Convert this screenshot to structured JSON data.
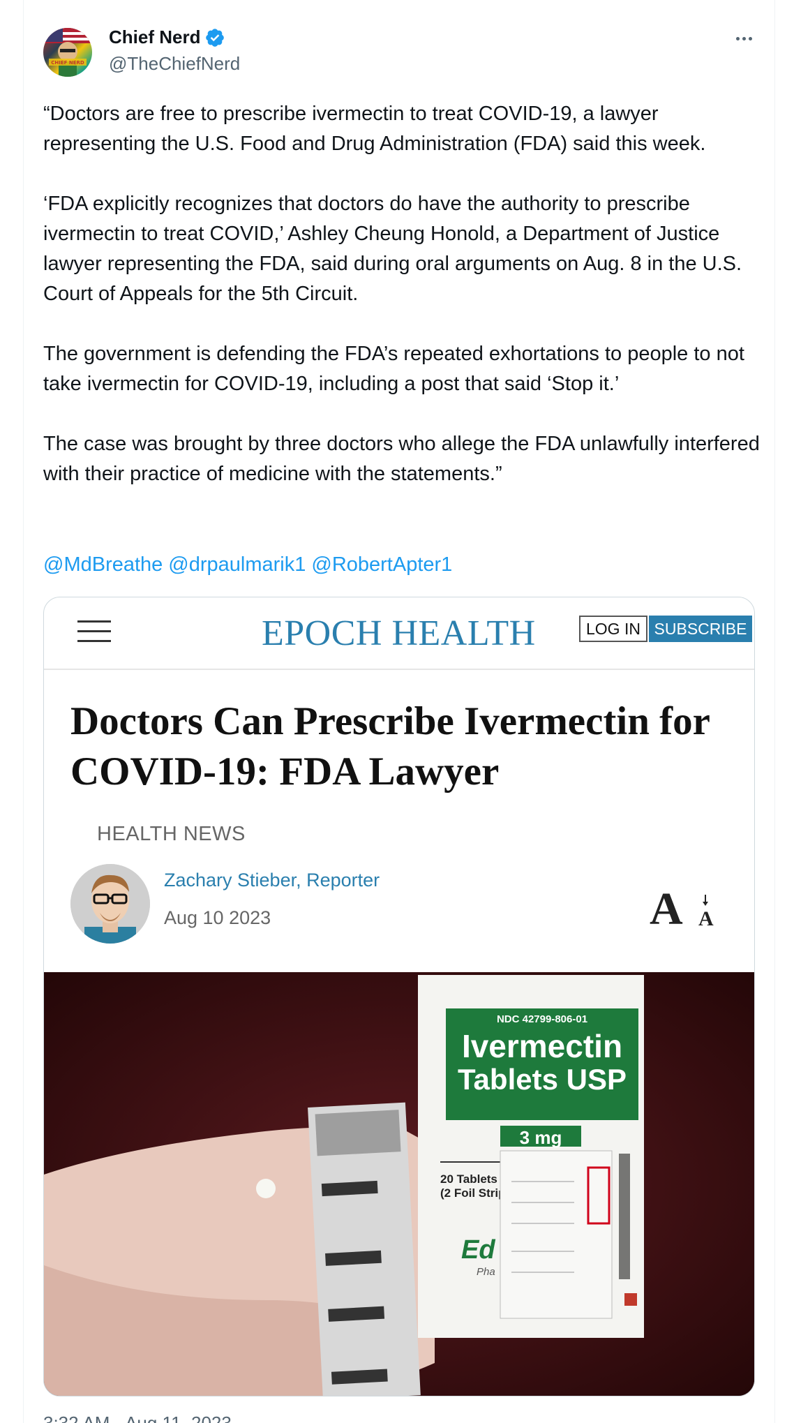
{
  "tweet": {
    "display_name": "Chief Nerd",
    "handle": "@TheChiefNerd",
    "avatar_text": "CHIEF NERD",
    "paragraphs": [
      "“Doctors are free to prescribe ivermectin to treat COVID-19, a lawyer representing the U.S. Food and Drug Administration (FDA) said this week.",
      "‘FDA explicitly recognizes that doctors do have the authority to prescribe ivermectin to treat COVID,’ Ashley Cheung Honold, a Department of Justice lawyer representing the FDA, said during oral arguments on Aug. 8 in the U.S. Court of Appeals for the 5th Circuit.",
      "The government is defending the FDA’s repeated exhortations to people to not take ivermectin for COVID-19, including a post that said ‘Stop it.’",
      "The case was brought by three doctors who allege the FDA unlawfully interfered with their practice of medicine with the statements.”"
    ],
    "mentions": [
      "@MdBreathe",
      "@drpaulmarik1",
      "@RobertApter1"
    ],
    "timestamp": "3:32 AM · Aug 11, 2023"
  },
  "card": {
    "logo": "EPOCH HEALTH",
    "login_label": "LOG IN",
    "subscribe_label": "SUBSCRIBE",
    "headline": "Doctors Can Prescribe Ivermectin for COVID-19: FDA Lawyer",
    "category": "HEALTH NEWS",
    "author": "Zachary Stieber, Reporter",
    "date": "Aug 10 2023",
    "font_size_glyph": "A",
    "photo": {
      "ndc": "NDC 42799-806-01",
      "drug_line1": "Ivermectin",
      "drug_line2": "Tablets USP",
      "dose": "3 mg",
      "count_line1": "20 Tablets",
      "count_line2": "(2 Foil Strip",
      "maker_partial": "Ed",
      "maker_sub": "Pha"
    }
  },
  "colors": {
    "link": "#1d9bf0",
    "verified": "#1d9bf0",
    "epoch_blue": "#2a7fae",
    "box_green": "#1e7a3c"
  },
  "icons": {
    "verified": "verified-badge-icon",
    "more": "more-options-icon",
    "menu": "hamburger-menu-icon",
    "font_size": "font-size-icon"
  }
}
